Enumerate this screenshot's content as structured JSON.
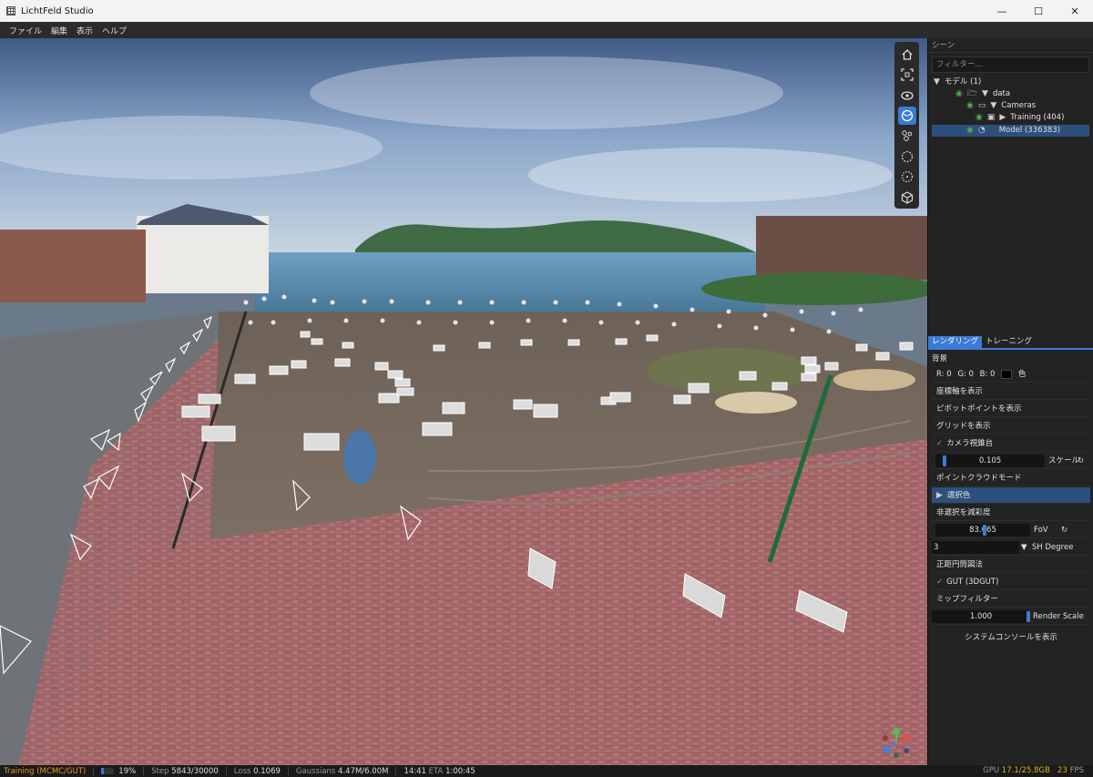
{
  "window": {
    "title": "LichtFeld Studio",
    "controls": [
      "—",
      "☐",
      "✕"
    ]
  },
  "menu": [
    "ファイル",
    "編集",
    "表示",
    "ヘルプ"
  ],
  "toolbar": {
    "icons": [
      "home-icon",
      "fit-view-icon",
      "orbit-icon",
      "splat-render-icon",
      "point-cloud-icon",
      "select-circle-icon",
      "select-dotted-icon",
      "cube-icon"
    ],
    "active": "splat-render-icon"
  },
  "scene_panel": {
    "title": "シーン",
    "filter_placeholder": "フィルター...",
    "tree": [
      {
        "label": "モデル (1)",
        "depth": 0
      },
      {
        "label": "data",
        "depth": 1
      },
      {
        "label": "Cameras",
        "depth": 2
      },
      {
        "label": "Training (404)",
        "depth": 3
      },
      {
        "label": "Model  (336383)",
        "depth": 2,
        "selected": true
      }
    ]
  },
  "tabs": [
    "レンダリング",
    "トレーニング"
  ],
  "active_tab": "レンダリング",
  "rendering": {
    "background_label": "背景",
    "r_label": "R: 0",
    "g_label": "G: 0",
    "b_label": "B: 0",
    "color_label": "色",
    "show_axes": "座標軸を表示",
    "show_pivot": "ピボットポイントを表示",
    "show_grid": "グリッドを表示",
    "camera_frustums": "カメラ視錐台",
    "frustum_scale_value": "0.105",
    "frustum_scale_label": "スケール",
    "point_cloud_mode": "ポイントクラウドモード",
    "selection_color": "選択色",
    "desaturate_unselected": "非選択を減彩度",
    "fov_value": "83.665",
    "fov_label": "FoV",
    "sh_degree_value": "3",
    "sh_degree_label": "SH Degree",
    "equirect": "正距円筒図法",
    "gut": "GUT (3DGUT)",
    "mip_filter": "ミップフィルター",
    "render_scale_value": "1.000",
    "render_scale_label": "Render Scale",
    "show_console": "システムコンソールを表示"
  },
  "status": {
    "mode": "Training (MCMC/GUT)",
    "progress_percent": "19%",
    "progress_fraction": 0.19,
    "step_label": "Step",
    "step_value": "5843/30000",
    "loss_label": "Loss",
    "loss_value": "0.1069",
    "gaussians_label": "Gaussians",
    "gaussians_value": "4.47M/6.00M",
    "elapsed": "14:41",
    "eta_label": "ETA",
    "eta_value": "1:00:45",
    "gpu_label": "GPU",
    "gpu_value": "17.1/25.8GB",
    "fps_value": "23",
    "fps_label": "FPS"
  },
  "colors": {
    "accent": "#3a7bd5",
    "training_status": "#e09a2b",
    "eye": "#4caf50"
  }
}
